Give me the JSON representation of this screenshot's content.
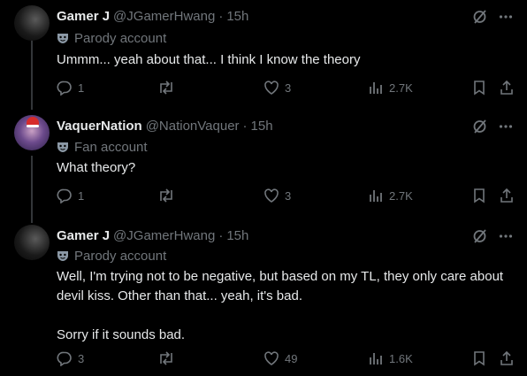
{
  "tweets": [
    {
      "name": "Gamer J",
      "handle": "@JGamerHwang",
      "separator": "·",
      "time": "15h",
      "account_label": "Parody account",
      "text": "Ummm... yeah about that... I think I know the theory",
      "replies": "1",
      "retweets": "",
      "likes": "3",
      "views": "2.7K"
    },
    {
      "name": "VaquerNation",
      "handle": "@NationVaquer",
      "separator": "·",
      "time": "15h",
      "account_label": "Fan account",
      "text": "What theory?",
      "replies": "1",
      "retweets": "",
      "likes": "3",
      "views": "2.7K"
    },
    {
      "name": "Gamer J",
      "handle": "@JGamerHwang",
      "separator": "·",
      "time": "15h",
      "account_label": "Parody account",
      "text": "Well, I'm trying not to be negative, but based on my TL, they only care about devil kiss. Other than that... yeah, it's bad.\n\nSorry if it sounds bad.",
      "replies": "3",
      "retweets": "",
      "likes": "49",
      "views": "1.6K"
    }
  ],
  "colors": {
    "background": "#000000",
    "text": "#e7e9ea",
    "muted": "#71767b",
    "thread_line": "#333639"
  },
  "icons": [
    "grok-icon",
    "more-icon",
    "reply-icon",
    "retweet-icon",
    "like-icon",
    "views-icon",
    "bookmark-icon",
    "share-icon",
    "mask-icon"
  ]
}
